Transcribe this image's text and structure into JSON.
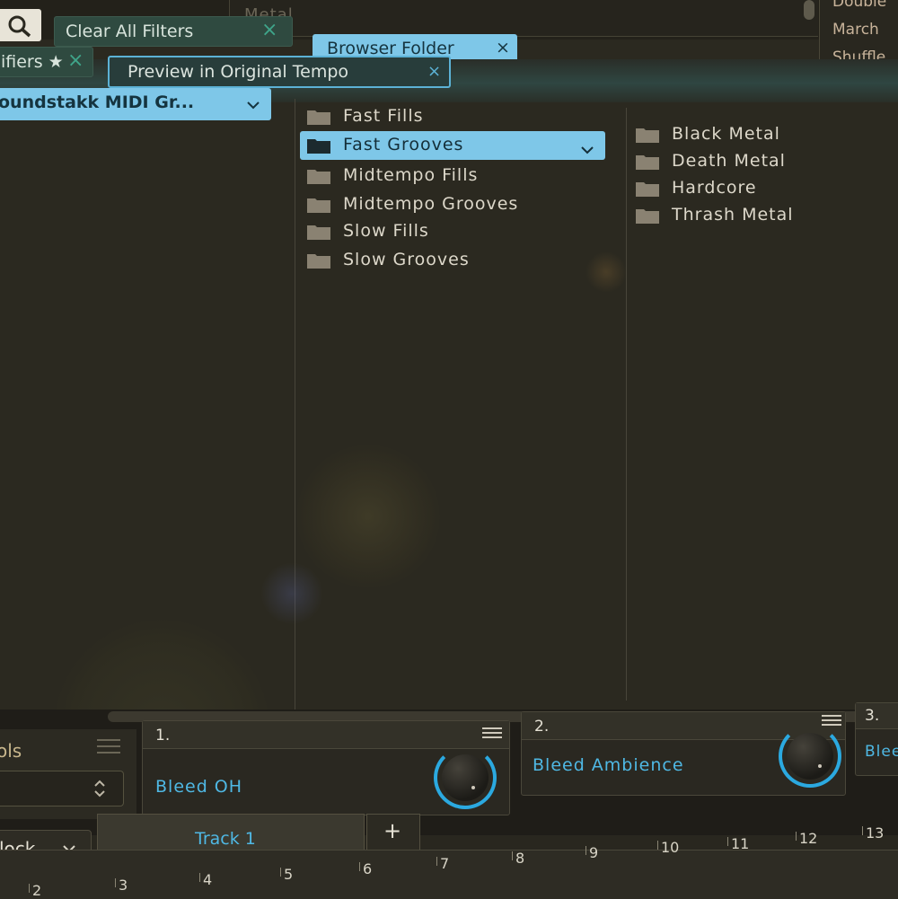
{
  "top": {
    "ghost_label": "Metal",
    "right_list": [
      "Double",
      "March",
      "Shuffle"
    ]
  },
  "toolbar": {
    "clear_filters_label": "Clear All Filters",
    "modifiers_label": "ifiers ★",
    "browser_folder_label": "Browser Folder",
    "preview_label": "Preview in Original Tempo",
    "close_glyph": "×"
  },
  "browser": {
    "library_dropdown": "oundstakk MIDI Gr...",
    "column2": [
      {
        "label": "Fast Fills",
        "selected": false
      },
      {
        "label": "Fast Grooves",
        "selected": true
      },
      {
        "label": "Midtempo Fills",
        "selected": false
      },
      {
        "label": "Midtempo Grooves",
        "selected": false
      },
      {
        "label": "Slow Fills",
        "selected": false
      },
      {
        "label": "Slow Grooves",
        "selected": false
      }
    ],
    "column3": [
      "Black Metal",
      "Death Metal",
      "Hardcore",
      "Thrash Metal"
    ]
  },
  "mixer": {
    "controls_label": "ols",
    "slots": [
      {
        "number": "1.",
        "name": "Bleed OH"
      },
      {
        "number": "2.",
        "name": "Bleed Ambience"
      },
      {
        "number": "3.",
        "name": "Blee"
      }
    ]
  },
  "tracks": {
    "clock_label": "lock",
    "tab_label": "Track 1",
    "add_label": "+",
    "ruler": [
      "2",
      "3",
      "4",
      "5",
      "6",
      "7",
      "8",
      "9",
      "10",
      "11",
      "12",
      "13"
    ]
  },
  "colors": {
    "accent": "#7ec7e8",
    "knob_ring": "#2ba9e0",
    "slot_text": "#4fb8e4"
  }
}
